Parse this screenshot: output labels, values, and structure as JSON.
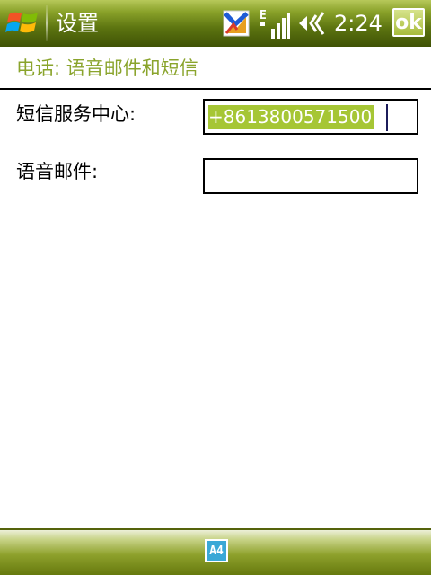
{
  "titlebar": {
    "title": "设置",
    "time": "2:24",
    "ok_label": "ok",
    "network_type": "E"
  },
  "page": {
    "header": "电话: 语音邮件和短信"
  },
  "form": {
    "sms_center_label": "短信服务中心:",
    "sms_center_value": "+8613800571500",
    "voicemail_label": "语音邮件:",
    "voicemail_value": ""
  },
  "softkeys": {
    "input_panel_label": "A4"
  },
  "colors": {
    "titlebar": "#5c7410",
    "header_text": "#8aa42c",
    "selection": "#a6c635"
  },
  "icons": [
    "windows-start-icon",
    "notification-icon",
    "signal-icon",
    "volume-icon",
    "keyboard-icon"
  ]
}
